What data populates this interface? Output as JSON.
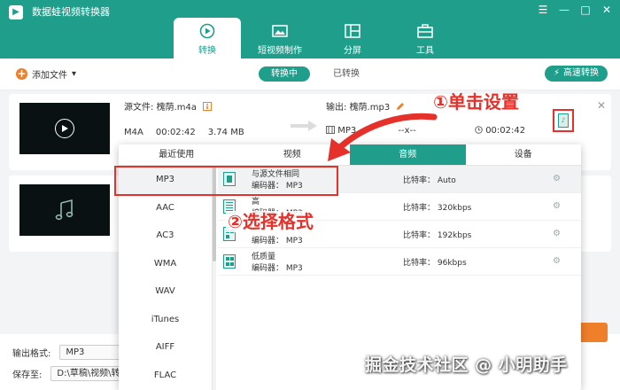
{
  "app": {
    "title": "数据蛙视频转换器",
    "logo_glyph": "▶",
    "win_controls": [
      "☰",
      "—",
      "□",
      "✕"
    ]
  },
  "nav": {
    "tabs": [
      {
        "label": "转换",
        "icon": "convert-icon",
        "active": true
      },
      {
        "label": "短视频制作",
        "icon": "short-video-icon",
        "active": false
      },
      {
        "label": "分屏",
        "icon": "split-screen-icon",
        "active": false
      },
      {
        "label": "工具",
        "icon": "toolbox-icon",
        "active": false
      }
    ]
  },
  "toolbar": {
    "add_file_label": "添加文件",
    "add_glyph": "+",
    "dropdown_glyph": "▾",
    "segment_converting": "转换中",
    "segment_converted": "已转换",
    "fast_convert_label": "高速转换",
    "fast_glyph": "⚡"
  },
  "file1": {
    "source_label": "源文件: 槐荫.m4a",
    "format": "M4A",
    "duration": "00:02:42",
    "size": "3.74 MB",
    "output_label": "输出: 槐荫.mp3",
    "output_format": "MP3",
    "output_dim": "--x--",
    "output_duration": "00:02:42",
    "format_button_glyph": "♪",
    "close_glyph": "✕"
  },
  "popup": {
    "tabs": [
      {
        "label": "最近使用",
        "active": false
      },
      {
        "label": "视频",
        "active": false
      },
      {
        "label": "音频",
        "active": true
      },
      {
        "label": "设备",
        "active": false
      }
    ],
    "formats": [
      "MP3",
      "AAC",
      "AC3",
      "WMA",
      "WAV",
      "iTunes",
      "AIFF",
      "FLAC"
    ],
    "selected_format_index": 0,
    "qualities": [
      {
        "name": "与源文件相同",
        "encoder": "编码器： MP3",
        "bitrate": "比特率： Auto",
        "selected": true
      },
      {
        "name": "高",
        "encoder": "编码器： MP3",
        "bitrate": "比特率： 320kbps",
        "selected": false
      },
      {
        "name": "",
        "encoder": "编码器： MP3",
        "bitrate": "比特率： 192kbps",
        "selected": false
      },
      {
        "name": "低质量",
        "encoder": "编码器： MP3",
        "bitrate": "比特率： 96kbps",
        "selected": false
      }
    ],
    "gear_glyph": "⚙"
  },
  "bottom": {
    "output_format_label": "输出格式:",
    "output_format_value": "MP3",
    "save_to_label": "保存至:",
    "save_to_value": "D:\\草稿\\视频\\转换"
  },
  "annotations": {
    "step1": "①单击设置",
    "step2": "②选择格式",
    "watermark": "掘金技术社区 @ 小明助手"
  },
  "colors": {
    "brand": "#1f9e8c",
    "accent_orange": "#f07f2a",
    "highlight_red": "#e6312b"
  }
}
